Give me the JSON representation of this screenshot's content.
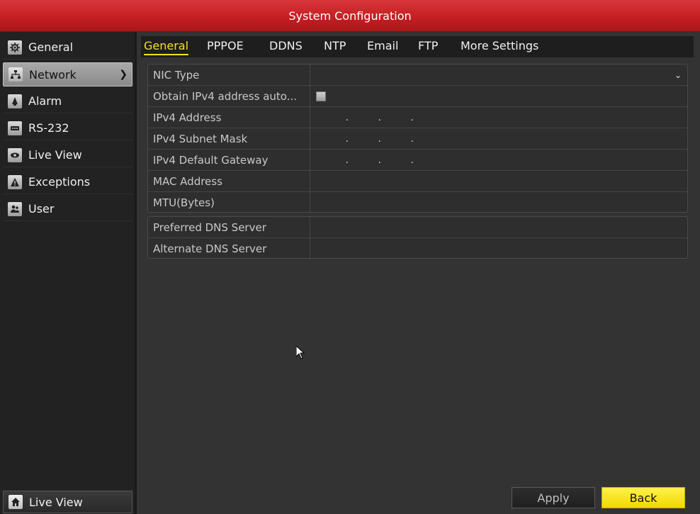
{
  "window": {
    "title": "System Configuration"
  },
  "sidebar": {
    "items": [
      {
        "label": "General",
        "icon": "gear-icon"
      },
      {
        "label": "Network",
        "icon": "network-icon"
      },
      {
        "label": "Alarm",
        "icon": "alarm-icon"
      },
      {
        "label": "RS-232",
        "icon": "serial-icon"
      },
      {
        "label": "Live View",
        "icon": "eye-icon"
      },
      {
        "label": "Exceptions",
        "icon": "warning-icon"
      },
      {
        "label": "User",
        "icon": "users-icon"
      }
    ],
    "active": "Network",
    "bottom_label": "Live View",
    "bottom_icon": "home-icon"
  },
  "tabs": [
    {
      "label": "General"
    },
    {
      "label": "PPPOE"
    },
    {
      "label": "DDNS"
    },
    {
      "label": "NTP"
    },
    {
      "label": "Email"
    },
    {
      "label": "FTP"
    },
    {
      "label": "More Settings"
    }
  ],
  "active_tab": "General",
  "form": {
    "nic_type": {
      "label": "NIC Type",
      "value": ""
    },
    "dhcp": {
      "label": "Obtain IPv4 address auto...",
      "checked": false
    },
    "ipv4_address": {
      "label": "IPv4 Address",
      "value": ". . ."
    },
    "subnet_mask": {
      "label": "IPv4 Subnet Mask",
      "value": ". . ."
    },
    "gateway": {
      "label": "IPv4 Default Gateway",
      "value": ". . ."
    },
    "mac_address": {
      "label": "MAC Address",
      "value": ""
    },
    "mtu": {
      "label": "MTU(Bytes)",
      "value": ""
    },
    "preferred_dns": {
      "label": "Preferred DNS Server",
      "value": ""
    },
    "alternate_dns": {
      "label": "Alternate DNS Server",
      "value": ""
    }
  },
  "buttons": {
    "apply": "Apply",
    "back": "Back"
  },
  "colors": {
    "title_red": "#c51f23",
    "tab_active": "#f5e21a",
    "back_yellow": "#f2d800"
  }
}
